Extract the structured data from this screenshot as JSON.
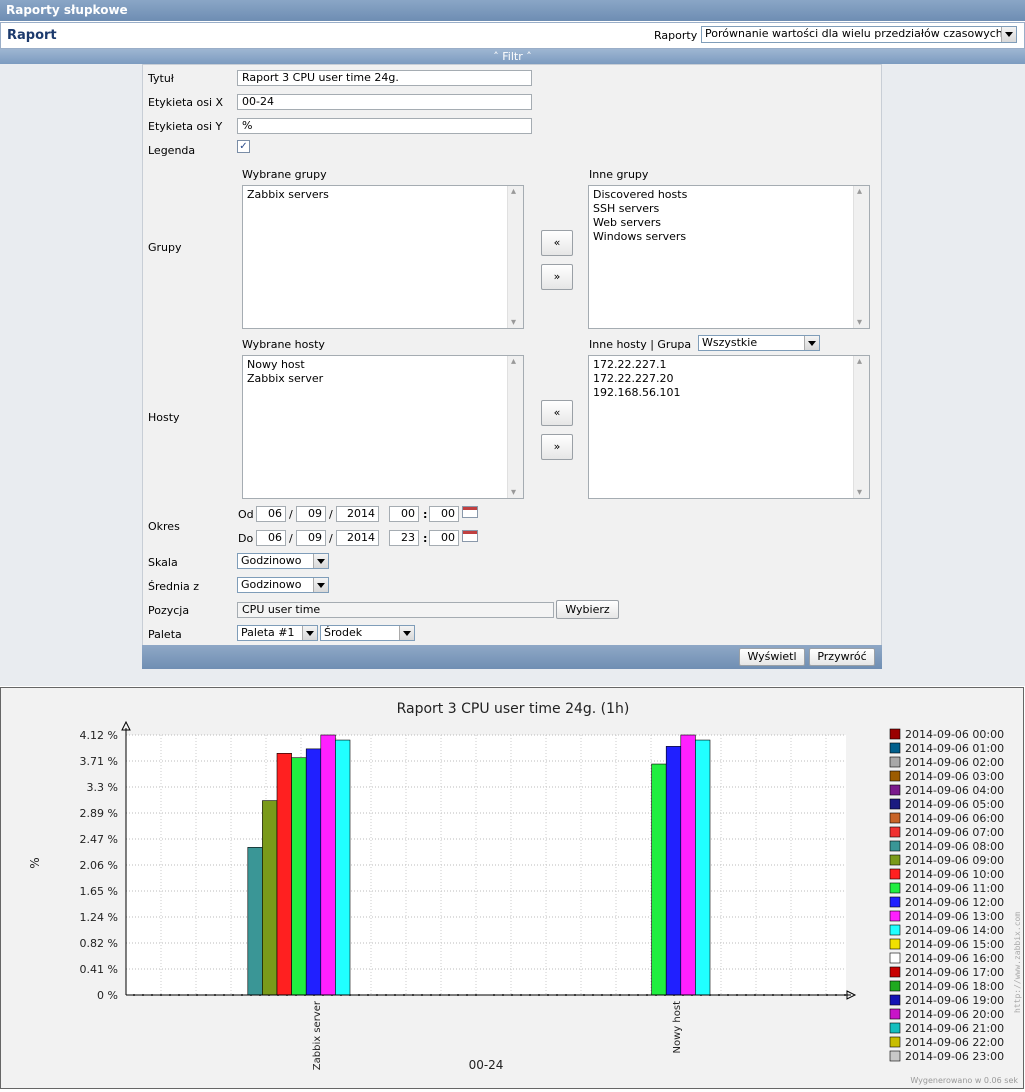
{
  "header": {
    "title": "Raporty słupkowe"
  },
  "report_bar": {
    "title": "Raport",
    "select_label": "Raporty",
    "select_value": "Porównanie wartości dla wielu przedziałów czasowych"
  },
  "filter_bar": {
    "label": "Filtr"
  },
  "form": {
    "title_label": "Tytuł",
    "title_value": "Raport 3 CPU user time 24g.",
    "xlabel_label": "Etykieta osi X",
    "xlabel_value": "00-24",
    "ylabel_label": "Etykieta osi Y",
    "ylabel_value": "%",
    "legend_label": "Legenda",
    "legend_checked": true,
    "groups_label": "Grupy",
    "selected_groups_title": "Wybrane grupy",
    "selected_groups": [
      "Zabbix servers"
    ],
    "other_groups_title": "Inne grupy",
    "other_groups": [
      "Discovered hosts",
      "SSH servers",
      "Web servers",
      "Windows servers"
    ],
    "hosts_label": "Hosty",
    "selected_hosts_title": "Wybrane hosty",
    "selected_hosts": [
      "Nowy host",
      "Zabbix server"
    ],
    "other_hosts_title": "Inne hosty | Grupa",
    "other_hosts_group": "Wszystkie",
    "other_hosts": [
      "172.22.227.1",
      "172.22.227.20",
      "192.168.56.101"
    ],
    "move_left": "«",
    "move_right": "»",
    "period_label": "Okres",
    "from_label": "Od",
    "from": {
      "day": "06",
      "month": "09",
      "year": "2014",
      "hour": "00",
      "minute": "00"
    },
    "to_label": "Do",
    "to": {
      "day": "06",
      "month": "09",
      "year": "2014",
      "hour": "23",
      "minute": "00"
    },
    "date_sep": "/",
    "time_sep": ":",
    "scale_label": "Skala",
    "scale_value": "Godzinowo",
    "average_label": "Średnia z",
    "average_value": "Godzinowo",
    "item_label": "Pozycja",
    "item_value": "CPU user time",
    "select_button": "Wybierz",
    "palette_label": "Paleta",
    "palette_value": "Paleta #1",
    "palette_type": "Środek",
    "show_button": "Wyświetl",
    "reset_button": "Przywróć"
  },
  "chart_data": {
    "type": "bar",
    "title": "Raport 3 CPU user time 24g. (1h)",
    "xlabel": "00-24",
    "ylabel": "%",
    "categories": [
      "Zabbix server",
      "Nowy host"
    ],
    "y_ticks": [
      "4.12 %",
      "3.71 %",
      "3.3 %",
      "2.89 %",
      "2.47 %",
      "2.06 %",
      "1.65 %",
      "1.24 %",
      "0.82 %",
      "0.41 %",
      "0 %"
    ],
    "ylim": [
      0,
      4.12
    ],
    "legend_position": "right",
    "series": [
      {
        "name": "2014-09-06 00:00",
        "color": "#9a0000",
        "values": [
          0,
          0
        ]
      },
      {
        "name": "2014-09-06 01:00",
        "color": "#005f8c",
        "values": [
          0,
          0
        ]
      },
      {
        "name": "2014-09-06 02:00",
        "color": "#a8a8a8",
        "values": [
          0,
          0
        ]
      },
      {
        "name": "2014-09-06 03:00",
        "color": "#9c5c00",
        "values": [
          0,
          0
        ]
      },
      {
        "name": "2014-09-06 04:00",
        "color": "#7a1a8c",
        "values": [
          0,
          0
        ]
      },
      {
        "name": "2014-09-06 05:00",
        "color": "#1a1a80",
        "values": [
          0,
          0
        ]
      },
      {
        "name": "2014-09-06 06:00",
        "color": "#c86428",
        "values": [
          0,
          0
        ]
      },
      {
        "name": "2014-09-06 07:00",
        "color": "#f03232",
        "values": [
          0,
          0
        ]
      },
      {
        "name": "2014-09-06 08:00",
        "color": "#3a9696",
        "values": [
          2.34,
          0
        ]
      },
      {
        "name": "2014-09-06 09:00",
        "color": "#7a9a1a",
        "values": [
          3.08,
          0
        ]
      },
      {
        "name": "2014-09-06 10:00",
        "color": "#ff2020",
        "values": [
          3.83,
          0
        ]
      },
      {
        "name": "2014-09-06 11:00",
        "color": "#20ee40",
        "values": [
          3.76,
          3.66
        ]
      },
      {
        "name": "2014-09-06 12:00",
        "color": "#2020ff",
        "values": [
          3.9,
          3.94
        ]
      },
      {
        "name": "2014-09-06 13:00",
        "color": "#ff20ff",
        "values": [
          4.12,
          4.12
        ]
      },
      {
        "name": "2014-09-06 14:00",
        "color": "#20ffff",
        "values": [
          4.04,
          4.04
        ]
      },
      {
        "name": "2014-09-06 15:00",
        "color": "#f0e000",
        "values": [
          0,
          0
        ]
      },
      {
        "name": "2014-09-06 16:00",
        "color": "#ffffff",
        "values": [
          0,
          0
        ]
      },
      {
        "name": "2014-09-06 17:00",
        "color": "#c80000",
        "values": [
          0,
          0
        ]
      },
      {
        "name": "2014-09-06 18:00",
        "color": "#20aa20",
        "values": [
          0,
          0
        ]
      },
      {
        "name": "2014-09-06 19:00",
        "color": "#1414b4",
        "values": [
          0,
          0
        ]
      },
      {
        "name": "2014-09-06 20:00",
        "color": "#c814c8",
        "values": [
          0,
          0
        ]
      },
      {
        "name": "2014-09-06 21:00",
        "color": "#14bebe",
        "values": [
          0,
          0
        ]
      },
      {
        "name": "2014-09-06 22:00",
        "color": "#c8be00",
        "values": [
          0,
          0
        ]
      },
      {
        "name": "2014-09-06 23:00",
        "color": "#c8c8c8",
        "values": [
          0,
          0
        ]
      }
    ],
    "watermark": "http://www.zabbix.com",
    "generated": "Wygenerowano w 0.06 sek"
  }
}
